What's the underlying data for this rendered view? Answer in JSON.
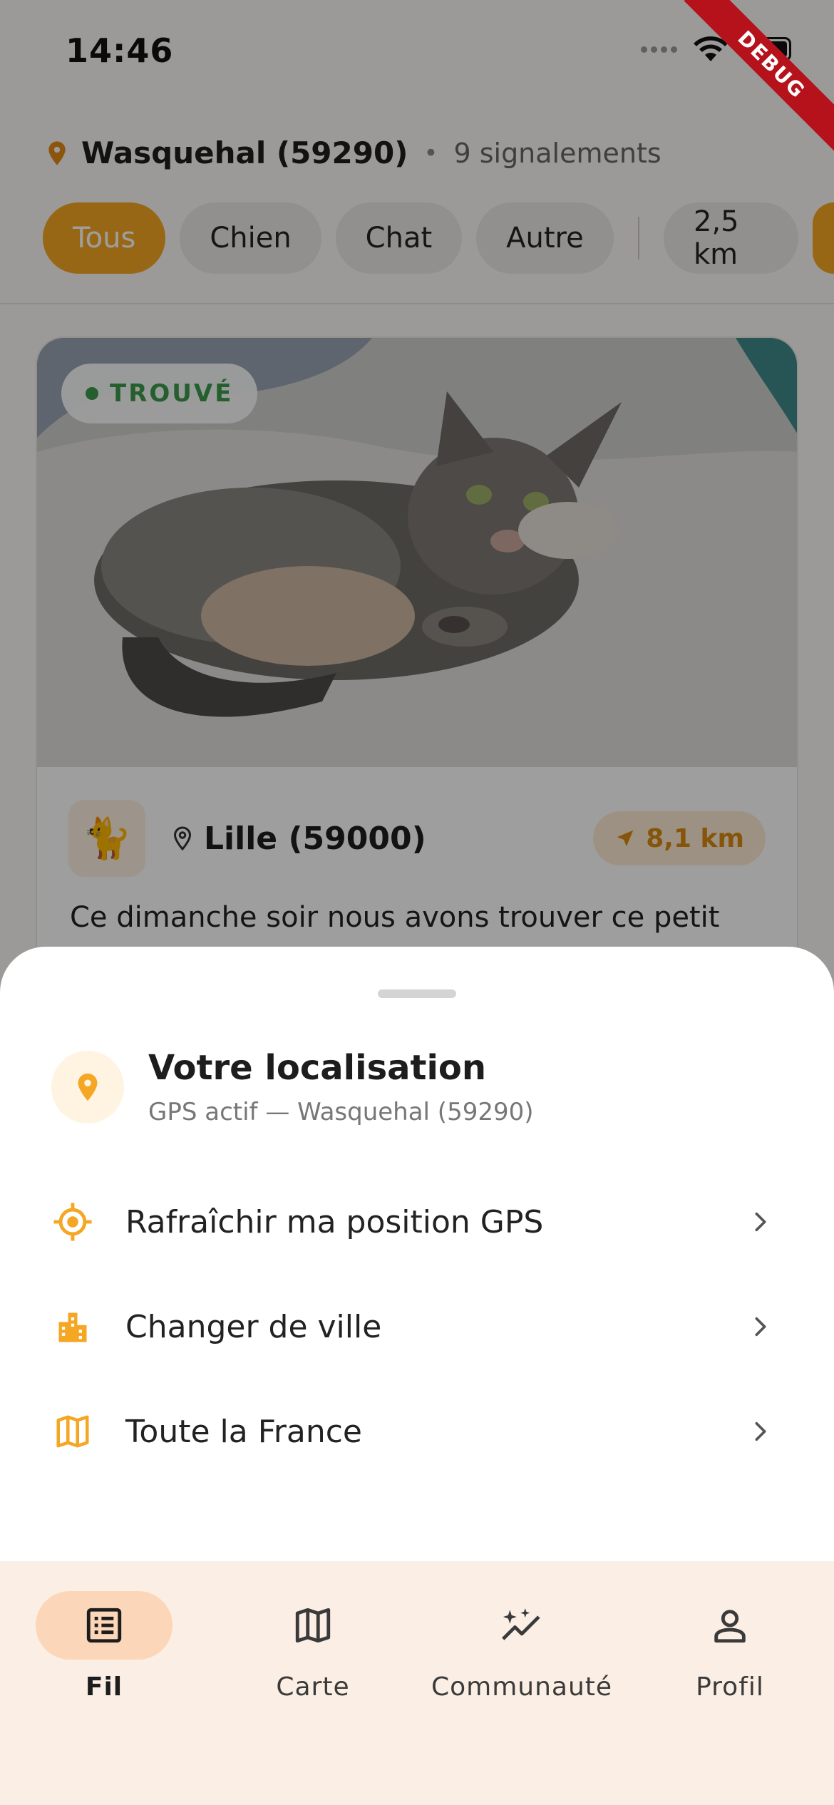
{
  "status_bar": {
    "time": "14:46",
    "debug_banner": "DEBUG"
  },
  "header": {
    "city": "Wasquehal (59290)",
    "separator": "•",
    "report_count": "9 signalements"
  },
  "filters": {
    "chips": [
      {
        "label": "Tous",
        "active": true
      },
      {
        "label": "Chien",
        "active": false
      },
      {
        "label": "Chat",
        "active": false
      },
      {
        "label": "Autre",
        "active": false
      }
    ],
    "radius": "2,5 km"
  },
  "card": {
    "status_badge": "TROUVÉ",
    "species_icon": "cat-emoji",
    "city": "Lille (59000)",
    "distance": "8,1 km",
    "description": "Ce dimanche soir nous avons trouver ce petit"
  },
  "sheet": {
    "title": "Votre localisation",
    "subtitle": "GPS actif — Wasquehal (59290)",
    "items": [
      {
        "label": "Rafraîchir ma position GPS",
        "icon": "gps-target-icon"
      },
      {
        "label": "Changer de ville",
        "icon": "city-buildings-icon"
      },
      {
        "label": "Toute la France",
        "icon": "map-icon"
      }
    ]
  },
  "nav": {
    "items": [
      {
        "label": "Fil",
        "icon": "feed-list-icon",
        "active": true
      },
      {
        "label": "Carte",
        "icon": "map-icon",
        "active": false
      },
      {
        "label": "Communauté",
        "icon": "sparkle-trend-icon",
        "active": false
      },
      {
        "label": "Profil",
        "icon": "person-icon",
        "active": false
      }
    ]
  },
  "colors": {
    "accent": "#f5a623",
    "found_green": "#3b9a4a",
    "nav_background": "#fbeee4",
    "nav_active_pill": "#fcd6b8"
  }
}
